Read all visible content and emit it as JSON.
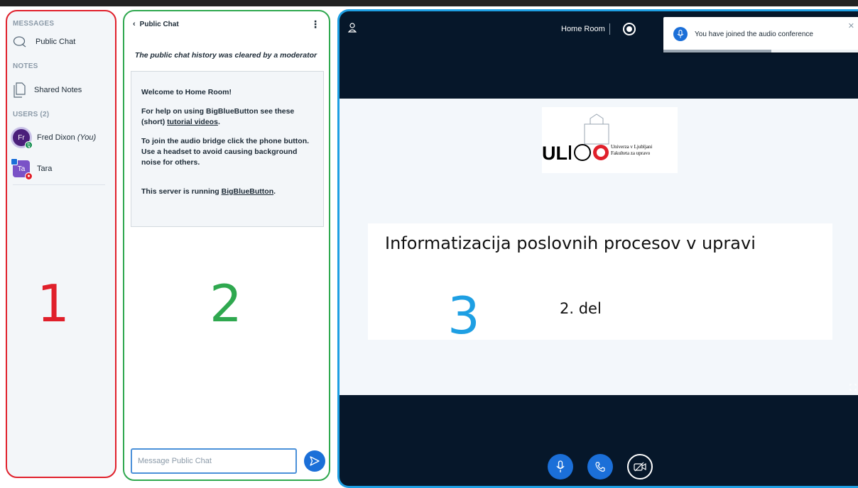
{
  "sidebar": {
    "messages_heading": "MESSAGES",
    "public_chat_label": "Public Chat",
    "notes_heading": "NOTES",
    "shared_notes_label": "Shared Notes",
    "users_heading": "USERS (2)",
    "users": [
      {
        "initials": "Fr",
        "name": "Fred Dixon",
        "suffix": "(You)"
      },
      {
        "initials": "Ta",
        "name": "Tara",
        "suffix": ""
      }
    ],
    "panel_number": "1"
  },
  "chat": {
    "title": "Public Chat",
    "cleared_notice": "The public chat history was cleared by a moderator",
    "welcome_prefix": "Welcome to ",
    "welcome_room": "Home Room",
    "welcome_suffix": "!",
    "help_prefix": "For help on using BigBlueButton see these (short) ",
    "help_link": "tutorial videos",
    "help_suffix": ".",
    "audio_text": "To join the audio bridge click the phone button. Use a headset to avoid causing background noise for others.",
    "server_prefix": "This server is running ",
    "server_link": "BigBlueButton",
    "server_suffix": ".",
    "input_placeholder": "Message Public Chat",
    "panel_number": "2"
  },
  "main": {
    "room_name": "Home Room",
    "toast": {
      "message": "You have joined the audio conference",
      "progress": 0.55
    },
    "slide": {
      "title": "Informatizacija poslovnih procesov v upravi",
      "subtitle": "2. del",
      "logo_text": "UL",
      "logo_line1": "Univerza v Ljubljani",
      "logo_line2": "Fakulteta za upravo"
    },
    "panel_number": "3"
  },
  "colors": {
    "panel1_border": "#e0202b",
    "panel2_border": "#2fa84f",
    "panel3_border": "#1e9fe3",
    "primary": "#1b6fd8",
    "dark_bg": "#06172a"
  },
  "icons": {
    "public_chat": "chat-bubble-icon",
    "shared_notes": "notes-icon",
    "mic": "microphone-icon",
    "phone": "phone-icon",
    "camera": "camera-off-icon",
    "send": "send-icon",
    "user": "user-icon",
    "record": "record-icon",
    "fullscreen": "fullscreen-icon"
  }
}
